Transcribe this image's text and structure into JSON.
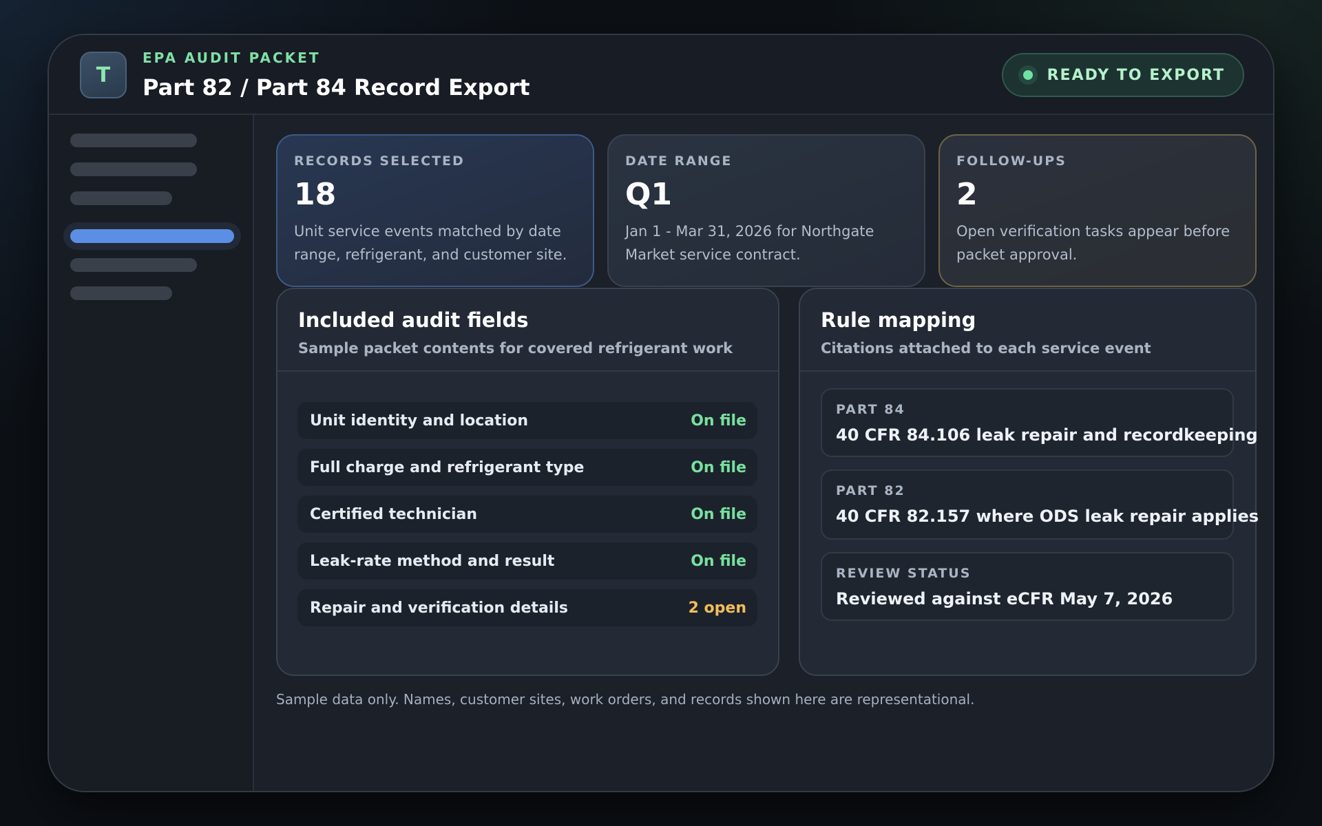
{
  "header": {
    "avatar_letter": "T",
    "eyebrow": "EPA AUDIT PACKET",
    "title": "Part 82 / Part 84 Record Export",
    "status_label": "READY TO EXPORT"
  },
  "stats": [
    {
      "label": "RECORDS SELECTED",
      "value": "18",
      "description": "Unit service events matched by date range, refrigerant, and customer site."
    },
    {
      "label": "DATE RANGE",
      "value": "Q1",
      "description": "Jan 1 - Mar 31, 2026 for Northgate Market service contract."
    },
    {
      "label": "FOLLOW-UPS",
      "value": "2",
      "description": "Open verification tasks appear before packet approval."
    }
  ],
  "fields_panel": {
    "title": "Included audit fields",
    "subtitle": "Sample packet contents for covered refrigerant work",
    "rows": [
      {
        "name": "Unit identity and location",
        "status": "On file"
      },
      {
        "name": "Full charge and refrigerant type",
        "status": "On file"
      },
      {
        "name": "Certified technician",
        "status": "On file"
      },
      {
        "name": "Leak-rate method and result",
        "status": "On file"
      },
      {
        "name": "Repair and verification details",
        "status": "2 open"
      }
    ]
  },
  "rules_panel": {
    "title": "Rule mapping",
    "subtitle": "Citations attached to each service event",
    "items": [
      {
        "label": "PART 84",
        "text": "40 CFR 84.106 leak repair and recordkeeping"
      },
      {
        "label": "PART 82",
        "text": "40 CFR 82.157 where ODS leak repair applies"
      },
      {
        "label": "REVIEW STATUS",
        "text": "Reviewed against eCFR May 7, 2026"
      }
    ]
  },
  "footnote": "Sample data only. Names, customer sites, work orders, and records shown here are representational.",
  "colors": {
    "accent_green": "#7fe0a6",
    "accent_blue": "#5b8fe6",
    "warning_amber": "#f2bd5a"
  }
}
